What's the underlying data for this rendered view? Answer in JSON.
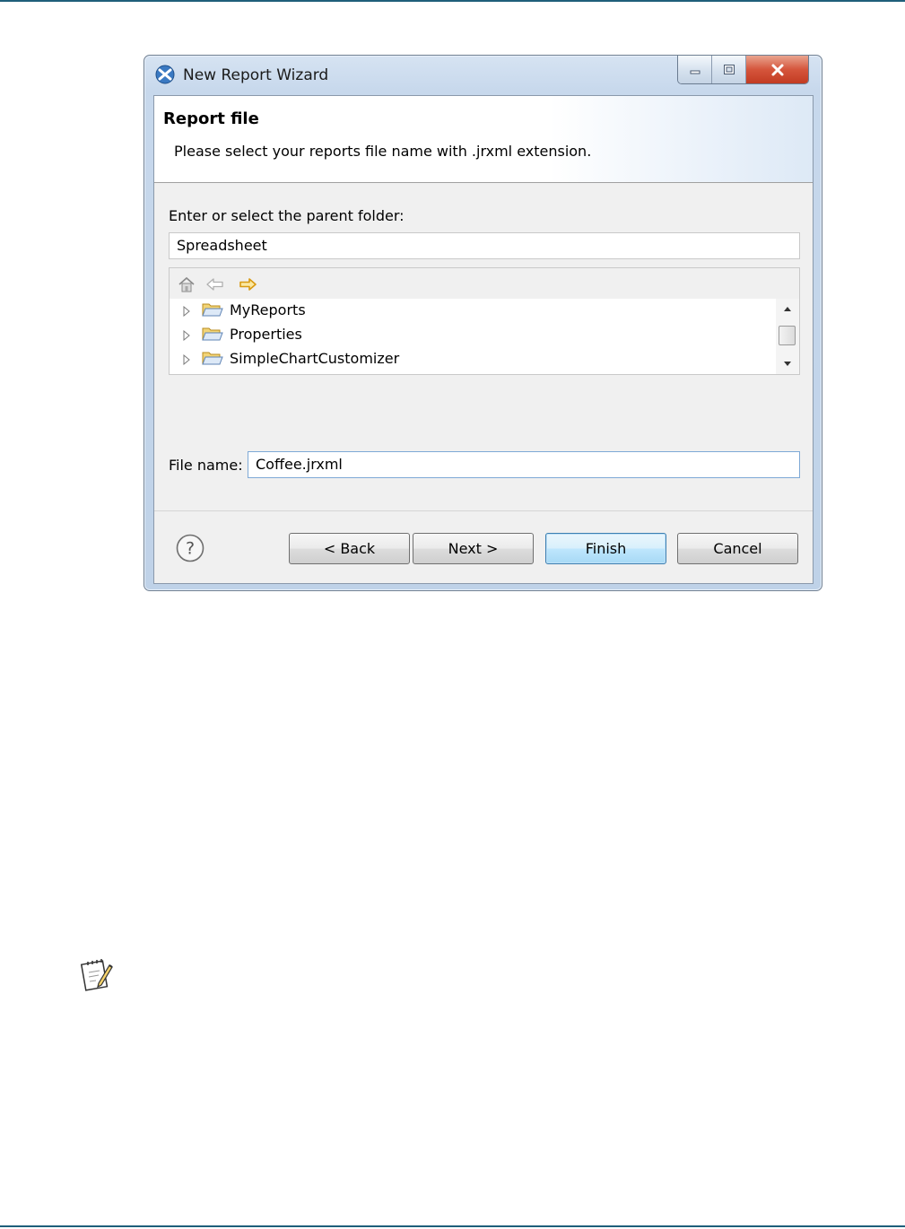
{
  "window": {
    "title": "New Report Wizard",
    "controls": {
      "minimize": "minimize-icon",
      "maximize": "maximize-icon",
      "close": "close-icon"
    }
  },
  "banner": {
    "title": "Report file",
    "description": "Please select your reports file name with .jrxml extension."
  },
  "folder": {
    "label": "Enter or select the parent folder:",
    "value": "Spreadsheet"
  },
  "tree": {
    "toolbar": [
      "home-icon",
      "back-arrow-icon",
      "forward-arrow-icon"
    ],
    "items": [
      {
        "label": "MyReports"
      },
      {
        "label": "Properties"
      },
      {
        "label": "SimpleChartCustomizer"
      }
    ]
  },
  "file": {
    "label": "File name:",
    "value": "Coffee.jrxml"
  },
  "buttons": {
    "back": "< Back",
    "next": "Next >",
    "finish": "Finish",
    "cancel": "Cancel"
  },
  "colors": {
    "accent_rule": "#1f5f7a",
    "default_button_border": "#3c7fb1",
    "close_button": "#c94a30"
  }
}
